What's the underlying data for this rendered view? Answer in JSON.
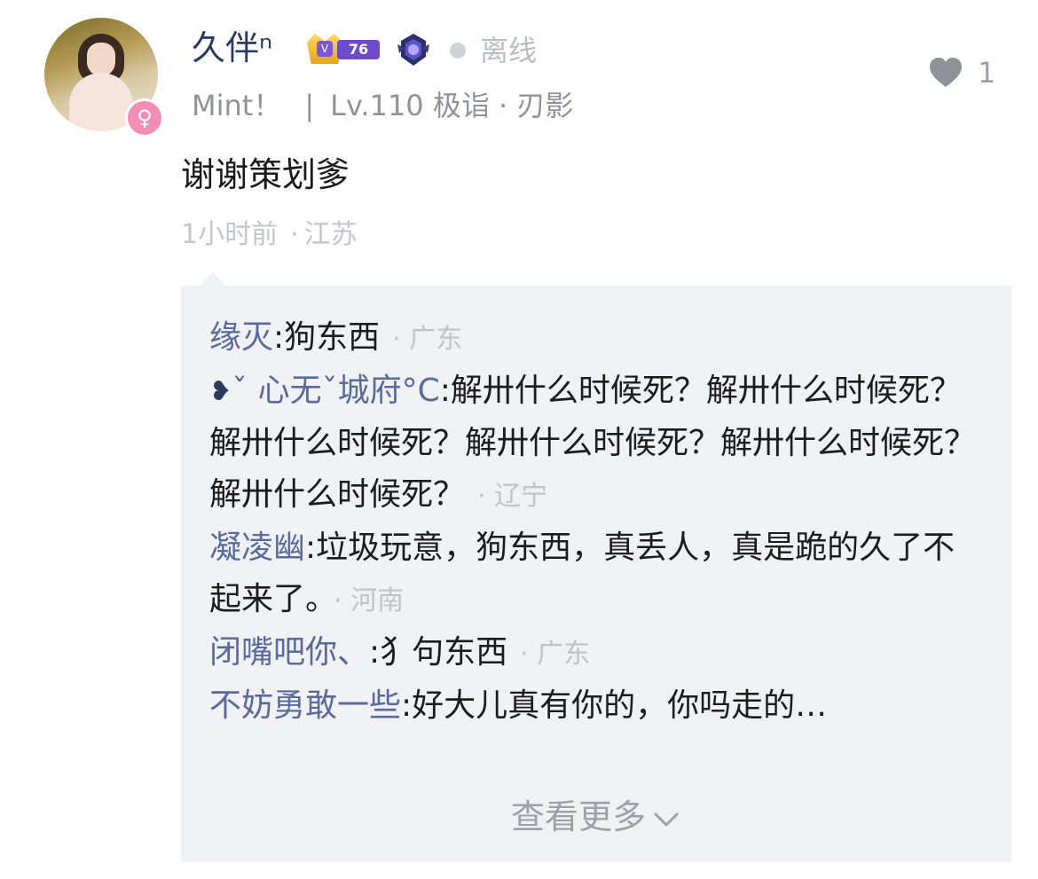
{
  "user": {
    "name": "久伴ⁿ",
    "rank_level": "76",
    "status": "离线",
    "guild": "Mint！",
    "separator": "|",
    "level_info": "Lv.110 极诣 · 刃影"
  },
  "likes": {
    "count": "1"
  },
  "comment": {
    "text": "谢谢策划爹",
    "time": "1小时前",
    "location": "江苏"
  },
  "replies": [
    {
      "name": "缘灭",
      "text": "狗东西",
      "location": "广东"
    },
    {
      "prefix": "❥",
      "name": "ˇ 心无ˇ城府°C",
      "text": "解卅什么时候死？解卅什么时候死？解卅什么时候死？解卅什么时候死？解卅什么时候死？解卅什么时候死？",
      "location": "辽宁"
    },
    {
      "name": "凝凌幽",
      "text": "垃圾玩意，狗东西，真丢人，真是跪的久了不起来了。",
      "location": "河南"
    },
    {
      "name": "闭嘴吧你、",
      "text": "犭句东西",
      "location": "广东"
    },
    {
      "name": "不妨勇敢一些",
      "text": "好大儿真有你的，你吗走的…",
      "location": ""
    }
  ],
  "view_more": "查看更多",
  "colors": {
    "name_blue": "#2b3a5e",
    "reply_name": "#5a6a99",
    "panel_bg": "#f0f1f4",
    "badge_pink": "#f48db4",
    "rank_purple": "#6d4bc9"
  }
}
